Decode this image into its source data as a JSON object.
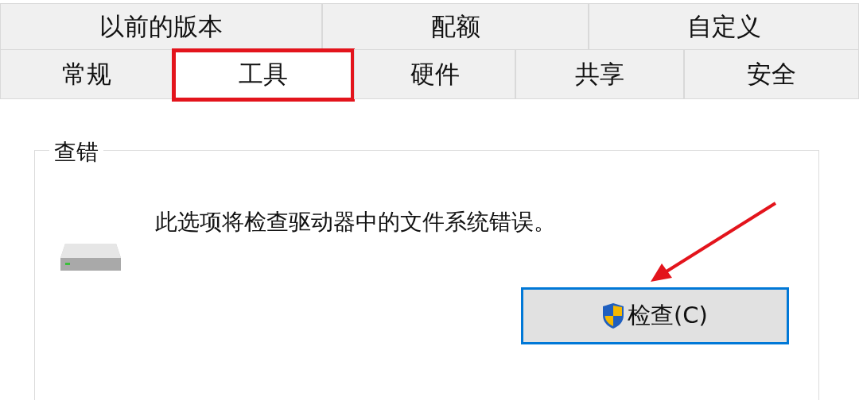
{
  "tabs": {
    "rows": [
      [
        {
          "label": "以前的版本",
          "selected": false
        },
        {
          "label": "配额",
          "selected": false
        },
        {
          "label": "自定义",
          "selected": false
        }
      ],
      [
        {
          "label": "常规",
          "selected": false
        },
        {
          "label": "工具",
          "selected": true
        },
        {
          "label": "硬件",
          "selected": false
        },
        {
          "label": "共享",
          "selected": false
        },
        {
          "label": "安全",
          "selected": false
        }
      ]
    ]
  },
  "group": {
    "title": "查错",
    "description": "此选项将检查驱动器中的文件系统错误。",
    "button": {
      "label": "检查(C)",
      "focused": true
    }
  },
  "annotations": {
    "selected_tab_framed": true,
    "arrow_to_button": true
  }
}
